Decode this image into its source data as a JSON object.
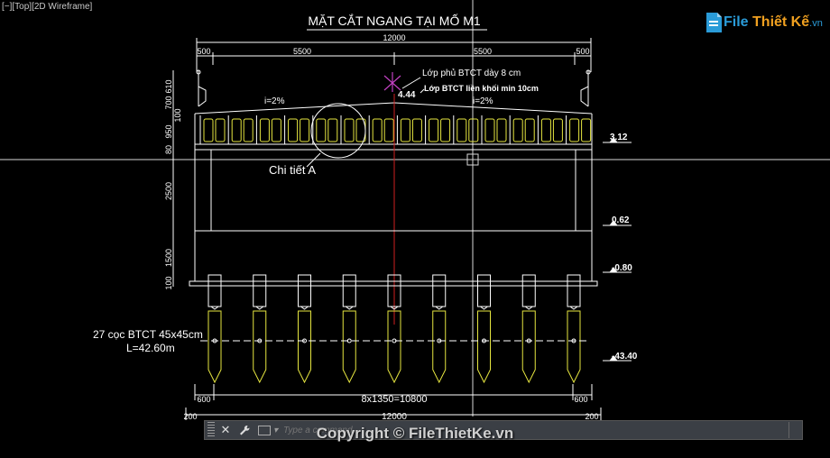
{
  "viewport": {
    "label": "[−][Top][2D Wireframe]"
  },
  "drawing": {
    "title": "MẶT CẮT NGANG TẠI MỐ M1",
    "top_dims": {
      "left": "500",
      "mid_left": "5500",
      "mid_right": "5500",
      "right": "500",
      "total": "12000"
    },
    "notes": {
      "overlay": "Lớp phủ BTCT dày 8 cm",
      "fill": "Lớp BTCT liền khối min 10cm",
      "slope_left": "i=2%",
      "slope_right": "i=2%",
      "crown": "4.44"
    },
    "left_dims": [
      "610",
      "700",
      "100",
      "950",
      "80",
      "2500",
      "1500",
      "100"
    ],
    "elevations": [
      "3.12",
      "0.62",
      "-0.80",
      "-43.40"
    ],
    "detail": "Chi tiết A",
    "piles": {
      "count": 9,
      "label_line1": "27 cọc BTCT 45x45cm",
      "label_line2": "L=42.60m"
    },
    "bottom_dims": {
      "left": "600",
      "right": "600",
      "spacing": "8x1350=10800",
      "edge_left": "200",
      "total": "12000",
      "edge_right": "200"
    }
  },
  "command_line": {
    "placeholder": "Type a command"
  },
  "watermark": {
    "logo_part1": "File ",
    "logo_part2": "Thiết Kế",
    "logo_ext": ".vn",
    "copyright": "Copyright © FileThietKe.vn"
  }
}
